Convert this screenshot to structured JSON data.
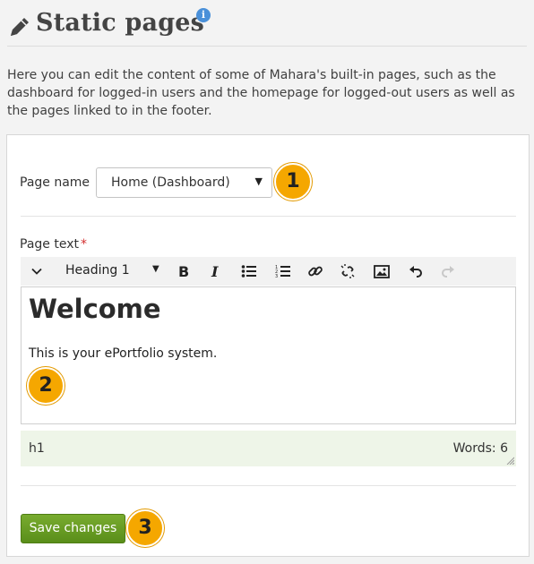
{
  "header": {
    "title": "Static pages",
    "info_icon": "i"
  },
  "intro": "Here you can edit the content of some of Mahara's built-in pages, such as the dashboard for logged-in users and the homepage for logged-out users as well as the pages linked to in the footer.",
  "form": {
    "page_name_label": "Page name",
    "page_name_value": "Home (Dashboard)",
    "page_text_label": "Page text",
    "required_marker": "*",
    "editor": {
      "format_value": "Heading 1",
      "toolbar_icons": [
        "chevron-down-icon",
        "bold-icon",
        "italic-icon",
        "bullet-list-icon",
        "numbered-list-icon",
        "link-icon",
        "unlink-icon",
        "image-icon",
        "undo-icon",
        "redo-icon"
      ],
      "content_heading": "Welcome",
      "content_paragraph": "This is your ePortfolio system.",
      "status_path": "h1",
      "word_count": "Words: 6"
    },
    "save_label": "Save changes"
  },
  "callouts": [
    "1",
    "2",
    "3"
  ],
  "colors": {
    "callout": "#f5a700",
    "save_button": "#6a9e24",
    "required": "#d32f2f",
    "info": "#4a90d9",
    "statusbar": "#eef5e8"
  }
}
